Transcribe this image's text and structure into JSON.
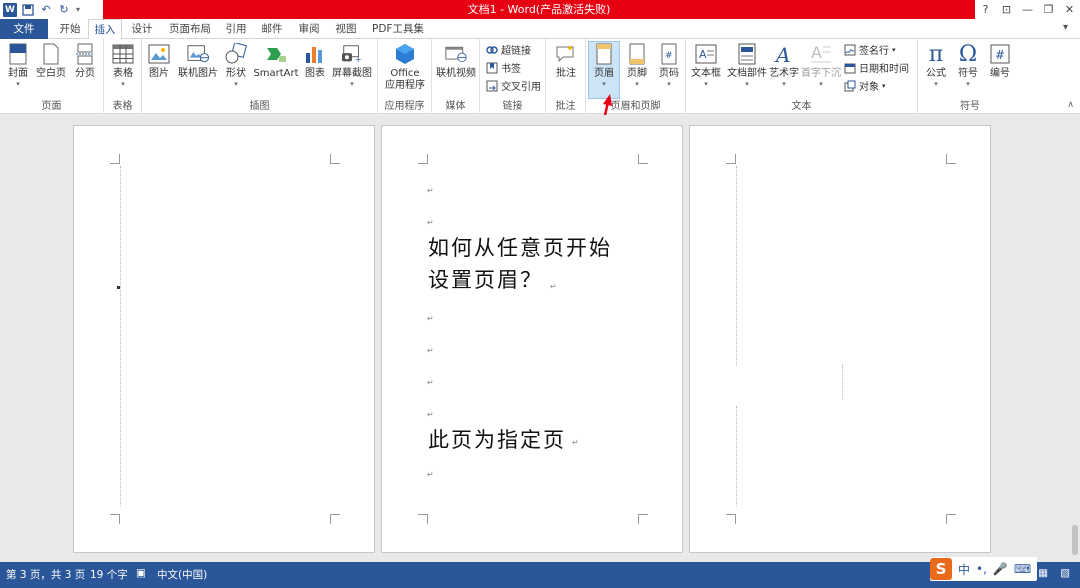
{
  "app": {
    "title": "文档1 - Word(产品激活失败)"
  },
  "window_controls": {
    "help": "?",
    "restore_ribbon": "⊡",
    "minimize": "—",
    "maximize": "❐",
    "close": "✕"
  },
  "account_menu_arrow": "▾",
  "tabs": [
    {
      "label": "文件"
    },
    {
      "label": "开始"
    },
    {
      "label": "插入"
    },
    {
      "label": "设计"
    },
    {
      "label": "页面布局"
    },
    {
      "label": "引用"
    },
    {
      "label": "邮件"
    },
    {
      "label": "审阅"
    },
    {
      "label": "视图"
    },
    {
      "label": "PDF工具集"
    }
  ],
  "ribbon": {
    "groups": {
      "pages": "页面",
      "tables": "表格",
      "illustrations": "插图",
      "apps": "应用程序",
      "media": "媒体",
      "links": "链接",
      "comments": "批注",
      "header_footer": "页眉和页脚",
      "text": "文本",
      "symbols": "符号"
    },
    "buttons": {
      "cover": "封面",
      "blank_page": "空白页",
      "page_break": "分页",
      "table": "表格",
      "picture": "图片",
      "online_picture": "联机图片",
      "shapes": "形状",
      "smartart": "SmartArt",
      "chart": "图表",
      "screenshot": "屏幕截图",
      "office_apps_1": "Office",
      "office_apps_2": "应用程序",
      "online_video": "联机视频",
      "hyperlink": "超链接",
      "bookmark": "书签",
      "cross_ref": "交叉引用",
      "comment": "批注",
      "header": "页眉",
      "footer": "页脚",
      "page_number": "页码",
      "text_box": "文本框",
      "quick_parts": "文档部件",
      "wordart": "艺术字",
      "drop_cap": "首字下沉",
      "signature_line": "签名行",
      "date_time": "日期和时间",
      "object": "对象",
      "equation": "公式",
      "symbol": "符号",
      "number": "编号"
    }
  },
  "document": {
    "heading_line1": "如何从任意页开始",
    "heading_line2": "设置页眉？",
    "body_text": "此页为指定页"
  },
  "status": {
    "page_info": "第 3 页，共 3 页",
    "word_count": "19 个字",
    "language": "中文(中国)"
  },
  "ime": {
    "logo": "S",
    "mode": "中",
    "punct": "•,",
    "mic": "🎤",
    "kbd": "⌨"
  },
  "colors": {
    "accent": "#2b579a",
    "title_bar": "#e60012",
    "arrow": "#e60012"
  }
}
